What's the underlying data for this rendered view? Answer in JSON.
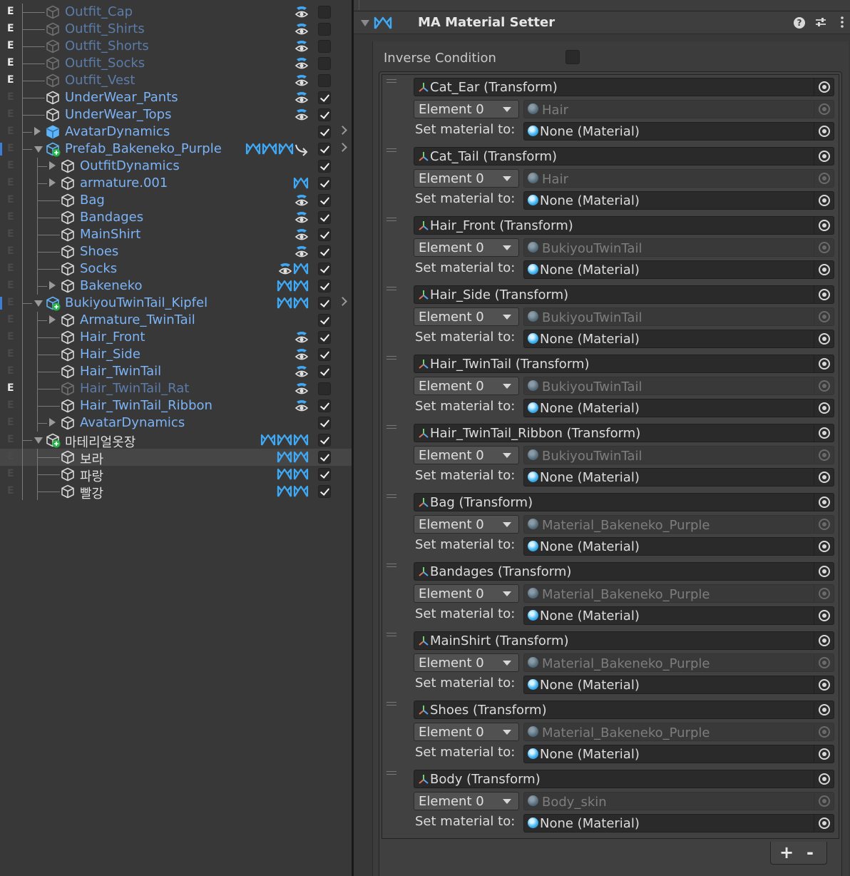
{
  "hierarchy": {
    "rows": [
      {
        "flag": "E",
        "depth": 0,
        "fold": "none",
        "name": "Outfit_Cap",
        "style": "inactive",
        "badges": [
          "eye"
        ],
        "checked": false,
        "arrow": false
      },
      {
        "flag": "E",
        "depth": 0,
        "fold": "none",
        "name": "Outfit_Shirts",
        "style": "inactive",
        "badges": [
          "eye"
        ],
        "checked": false,
        "arrow": false
      },
      {
        "flag": "E",
        "depth": 0,
        "fold": "none",
        "name": "Outfit_Shorts",
        "style": "inactive",
        "badges": [
          "eye"
        ],
        "checked": false,
        "arrow": false
      },
      {
        "flag": "E",
        "depth": 0,
        "fold": "none",
        "name": "Outfit_Socks",
        "style": "inactive",
        "badges": [
          "eye"
        ],
        "checked": false,
        "arrow": false
      },
      {
        "flag": "E",
        "depth": 0,
        "fold": "none",
        "name": "Outfit_Vest",
        "style": "inactive",
        "badges": [
          "eye"
        ],
        "checked": false,
        "arrow": false
      },
      {
        "flag": "",
        "depth": 0,
        "fold": "none",
        "name": "UnderWear_Pants",
        "style": "prefab",
        "badges": [
          "eye"
        ],
        "checked": true,
        "arrow": false
      },
      {
        "flag": "",
        "depth": 0,
        "fold": "none",
        "name": "UnderWear_Tops",
        "style": "prefab",
        "badges": [
          "eye"
        ],
        "checked": true,
        "arrow": false
      },
      {
        "flag": "",
        "depth": 0,
        "fold": "closed",
        "name": "AvatarDynamics",
        "style": "prefab",
        "icon": "prefab",
        "badges": [],
        "checked": true,
        "arrow": true
      },
      {
        "flag": "",
        "depth": 0,
        "fold": "open",
        "name": "Prefab_Bakeneko_Purple",
        "style": "prefab",
        "icon": "prefab-root",
        "badges": [
          "ma",
          "ma",
          "ma",
          "jump"
        ],
        "checked": true,
        "arrow": true,
        "mark": true
      },
      {
        "flag": "",
        "depth": 1,
        "fold": "closed",
        "name": "OutfitDynamics",
        "style": "prefab",
        "badges": [],
        "checked": true,
        "arrow": false
      },
      {
        "flag": "",
        "depth": 1,
        "fold": "closed",
        "name": "armature.001",
        "style": "prefab",
        "badges": [
          "ma"
        ],
        "checked": true,
        "arrow": false
      },
      {
        "flag": "",
        "depth": 1,
        "fold": "none",
        "name": "Bag",
        "style": "prefab",
        "badges": [
          "eye"
        ],
        "checked": true,
        "arrow": false
      },
      {
        "flag": "",
        "depth": 1,
        "fold": "none",
        "name": "Bandages",
        "style": "prefab",
        "badges": [
          "eye"
        ],
        "checked": true,
        "arrow": false
      },
      {
        "flag": "",
        "depth": 1,
        "fold": "none",
        "name": "MainShirt",
        "style": "prefab",
        "badges": [
          "eye"
        ],
        "checked": true,
        "arrow": false
      },
      {
        "flag": "",
        "depth": 1,
        "fold": "none",
        "name": "Shoes",
        "style": "prefab",
        "badges": [
          "eye"
        ],
        "checked": true,
        "arrow": false
      },
      {
        "flag": "",
        "depth": 1,
        "fold": "none",
        "name": "Socks",
        "style": "prefab",
        "badges": [
          "eye",
          "ma"
        ],
        "checked": true,
        "arrow": false
      },
      {
        "flag": "",
        "depth": 1,
        "fold": "closed",
        "name": "Bakeneko",
        "style": "prefab",
        "badges": [
          "ma",
          "ma"
        ],
        "checked": true,
        "arrow": false
      },
      {
        "flag": "",
        "depth": 0,
        "fold": "open",
        "name": "BukiyouTwinTail_Kipfel",
        "style": "prefab",
        "icon": "prefab-root",
        "badges": [
          "ma",
          "ma"
        ],
        "checked": true,
        "arrow": true,
        "mark": true
      },
      {
        "flag": "",
        "depth": 1,
        "fold": "closed",
        "name": "Armature_TwinTail",
        "style": "prefab",
        "badges": [],
        "checked": true,
        "arrow": false
      },
      {
        "flag": "",
        "depth": 1,
        "fold": "none",
        "name": "Hair_Front",
        "style": "prefab",
        "badges": [
          "eye"
        ],
        "checked": true,
        "arrow": false
      },
      {
        "flag": "",
        "depth": 1,
        "fold": "none",
        "name": "Hair_Side",
        "style": "prefab",
        "badges": [
          "eye"
        ],
        "checked": true,
        "arrow": false
      },
      {
        "flag": "",
        "depth": 1,
        "fold": "none",
        "name": "Hair_TwinTail",
        "style": "prefab",
        "badges": [
          "eye"
        ],
        "checked": true,
        "arrow": false
      },
      {
        "flag": "E",
        "depth": 1,
        "fold": "none",
        "name": "Hair_TwinTail_Rat",
        "style": "inactive",
        "badges": [
          "eye"
        ],
        "checked": false,
        "arrow": false
      },
      {
        "flag": "",
        "depth": 1,
        "fold": "none",
        "name": "Hair_TwinTail_Ribbon",
        "style": "prefab",
        "badges": [
          "eye"
        ],
        "checked": true,
        "arrow": false
      },
      {
        "flag": "",
        "depth": 1,
        "fold": "closed",
        "name": "AvatarDynamics",
        "style": "prefab",
        "badges": [],
        "checked": true,
        "arrow": false
      },
      {
        "flag": "",
        "depth": 0,
        "fold": "open",
        "name": "마테리얼옷장",
        "style": "normal",
        "icon": "added",
        "badges": [
          "ma",
          "ma",
          "ma"
        ],
        "checked": true,
        "arrow": false
      },
      {
        "flag": "",
        "depth": 1,
        "fold": "none",
        "name": "보라",
        "style": "normal",
        "badges": [
          "ma",
          "ma"
        ],
        "checked": true,
        "arrow": false,
        "selected": true
      },
      {
        "flag": "",
        "depth": 1,
        "fold": "none",
        "name": "파랑",
        "style": "normal",
        "badges": [
          "ma",
          "ma"
        ],
        "checked": true,
        "arrow": false
      },
      {
        "flag": "",
        "depth": 1,
        "fold": "none",
        "name": "빨강",
        "style": "normal",
        "badges": [
          "ma",
          "ma"
        ],
        "checked": true,
        "arrow": false
      }
    ]
  },
  "inspector": {
    "component_title": "MA Material Setter",
    "help_label": "?",
    "inverse_condition_label": "Inverse Condition",
    "inverse_condition_checked": false,
    "set_material_label": "Set material to:",
    "footer": {
      "add": "+",
      "remove": "-"
    },
    "entries": [
      {
        "object": "Cat_Ear (Transform)",
        "element": "Element 0",
        "current": "Hair",
        "target": "None (Material)"
      },
      {
        "object": "Cat_Tail (Transform)",
        "element": "Element 0",
        "current": "Hair",
        "target": "None (Material)"
      },
      {
        "object": "Hair_Front (Transform)",
        "element": "Element 0",
        "current": "BukiyouTwinTail",
        "target": "None (Material)"
      },
      {
        "object": "Hair_Side (Transform)",
        "element": "Element 0",
        "current": "BukiyouTwinTail",
        "target": "None (Material)"
      },
      {
        "object": "Hair_TwinTail (Transform)",
        "element": "Element 0",
        "current": "BukiyouTwinTail",
        "target": "None (Material)"
      },
      {
        "object": "Hair_TwinTail_Ribbon (Transform)",
        "element": "Element 0",
        "current": "BukiyouTwinTail",
        "target": "None (Material)"
      },
      {
        "object": "Bag (Transform)",
        "element": "Element 0",
        "current": "Material_Bakeneko_Purple",
        "target": "None (Material)"
      },
      {
        "object": "Bandages (Transform)",
        "element": "Element 0",
        "current": "Material_Bakeneko_Purple",
        "target": "None (Material)"
      },
      {
        "object": "MainShirt (Transform)",
        "element": "Element 0",
        "current": "Material_Bakeneko_Purple",
        "target": "None (Material)"
      },
      {
        "object": "Shoes (Transform)",
        "element": "Element 0",
        "current": "Material_Bakeneko_Purple",
        "target": "None (Material)"
      },
      {
        "object": "Body (Transform)",
        "element": "Element 0",
        "current": "Body_skin",
        "target": "None (Material)"
      }
    ]
  },
  "colors": {
    "prefab_text": "#7cb3f5",
    "inactive_text": "#5b7ca8",
    "ma_icon": "#3fa9f5",
    "panel_bg": "#383838"
  },
  "icons": {
    "object": "cube-icon",
    "prefab": "prefab-cube-icon",
    "eye": "visibility-eye-icon",
    "ma": "modular-avatar-icon",
    "transform": "transform-axes-icon",
    "material": "material-sphere-icon",
    "picker": "object-picker-icon"
  }
}
